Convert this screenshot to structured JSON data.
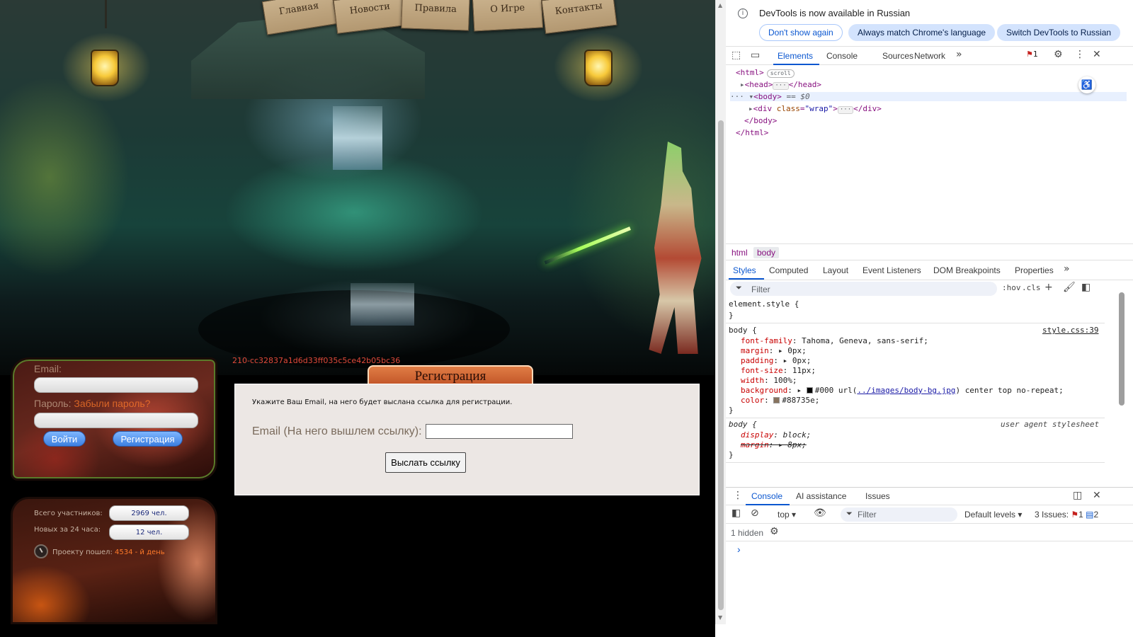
{
  "site": {
    "nav": [
      "Главная",
      "Новости",
      "Правила",
      "О Игре",
      "Контакты"
    ],
    "hash": "210-cc32837a1d6d33ff035c5ce42b05bc36",
    "registration": {
      "title": "Регистрация",
      "instruction": "Укажите Ваш Email, на него будет выслана ссылка для регистрации.",
      "email_label": "Email (На него вышлем ссылку):",
      "email_value": "",
      "send_button": "Выслать ссылку"
    },
    "login": {
      "email_label": "Email:",
      "password_label": "Пароль:",
      "forgot_link": "Забыли пароль?",
      "login_button": "Войти",
      "register_button": "Регистрация"
    },
    "stats": {
      "total_label": "Всего участников:",
      "total_value": "2969 чел.",
      "new_label": "Новых за 24 часа:",
      "new_value": "12 чел.",
      "days_prefix": "Проекту пошел:",
      "days_value": "4534 - й день"
    }
  },
  "devtools": {
    "notice": {
      "text": "DevTools is now available in Russian",
      "buttons": [
        "Don't show again",
        "Always match Chrome's language",
        "Switch DevTools to Russian"
      ]
    },
    "tabs": [
      "Elements",
      "Console",
      "Sources",
      "Network"
    ],
    "active_tab": "Elements",
    "issues_badge": "1",
    "dom": {
      "html_open": "<html>",
      "scroll_badge": "scroll",
      "head": "<head>",
      "head_close": "</head>",
      "body_open": "<body>",
      "body_eq": "== $0",
      "div_tag": "<div ",
      "div_attr_name": "class",
      "div_attr_val": "\"wrap\"",
      "div_close": "</div>",
      "body_close": "</body>",
      "html_close": "</html>"
    },
    "breadcrumbs": [
      "html",
      "body"
    ],
    "style_tabs": [
      "Styles",
      "Computed",
      "Layout",
      "Event Listeners",
      "DOM Breakpoints",
      "Properties"
    ],
    "filter_placeholder": "Filter",
    "hov": ":hov",
    "cls": ".cls",
    "styles": {
      "element_style": "element.style {",
      "close_brace": "}",
      "body_rule": "body {",
      "source": "style.css:39",
      "font_family_prop": "font-family",
      "font_family_val": "Tahoma, Geneva, sans-serif;",
      "margin_prop": "margin",
      "margin_val": "0px;",
      "padding_prop": "padding",
      "padding_val": "0px;",
      "font_size_prop": "font-size",
      "font_size_val": "11px;",
      "width_prop": "width",
      "width_val": "100%;",
      "background_prop": "background",
      "background_color": "#000",
      "background_url": "../images/body-bg.jpg",
      "background_rest": "center top no-repeat;",
      "color_prop": "color",
      "color_val": "#88735e;",
      "ua_rule": "body {",
      "ua_source": "user agent stylesheet",
      "display_prop": "display",
      "display_val": "block;",
      "ua_margin_prop": "margin",
      "ua_margin_val": "8px;"
    },
    "drawer": {
      "tabs": [
        "Console",
        "AI assistance",
        "Issues"
      ],
      "context": "top",
      "filter_placeholder": "Filter",
      "levels": "Default levels",
      "issues_label": "3 Issues:",
      "issues_warn": "1",
      "issues_info": "2",
      "hidden": "1 hidden"
    }
  },
  "colors": {
    "accent": "#0b57d0",
    "swatch_black": "#000000",
    "swatch_text": "#88735e",
    "orange_link": "#ff7a2a"
  }
}
